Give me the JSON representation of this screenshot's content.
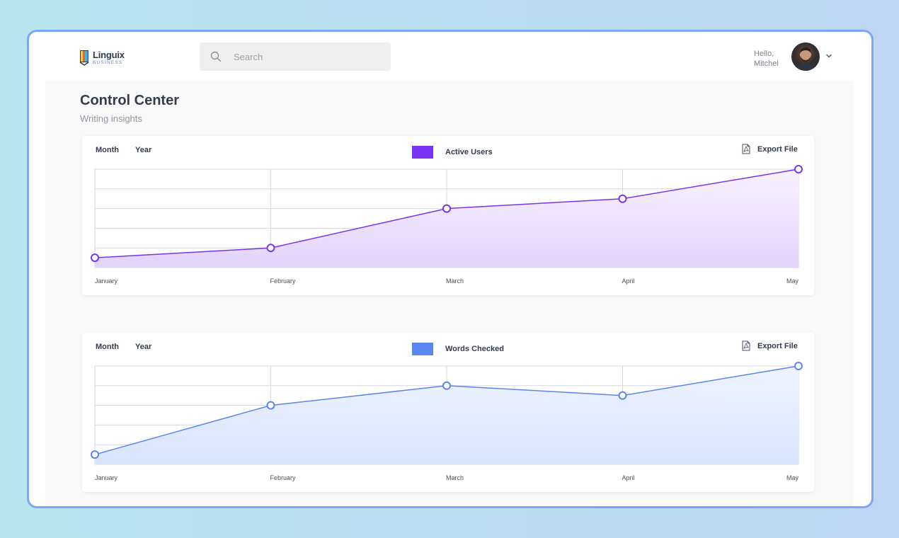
{
  "header": {
    "logo_name": "Linguix",
    "logo_sub": "BUSINESS",
    "search_placeholder": "Search",
    "greeting_line1": "Hello,",
    "greeting_line2": "Mitchel"
  },
  "page": {
    "title": "Control Center",
    "subtitle": "Writing insights"
  },
  "cards": [
    {
      "tab_month": "Month",
      "tab_year": "Year",
      "legend_label": "Active Users",
      "export_label": "Export File",
      "color": "#7a33f2",
      "fill_top": "#f8f2fe",
      "fill_bottom": "#e2d3fb"
    },
    {
      "tab_month": "Month",
      "tab_year": "Year",
      "legend_label": "Words Checked",
      "export_label": "Export File",
      "color": "#5b86f0",
      "fill_top": "#eef3fe",
      "fill_bottom": "#d9e4fc"
    }
  ],
  "chart_data": [
    {
      "type": "area",
      "categories": [
        "January",
        "February",
        "March",
        "April",
        "May"
      ],
      "series": [
        {
          "name": "Active Users",
          "values": [
            0.5,
            1.0,
            3.0,
            3.5,
            5.0
          ]
        }
      ],
      "ylim": [
        0,
        5
      ],
      "grid": true,
      "legend_position": "top-center"
    },
    {
      "type": "area",
      "categories": [
        "January",
        "February",
        "March",
        "April",
        "May"
      ],
      "series": [
        {
          "name": "Words Checked",
          "values": [
            0.5,
            3.0,
            4.0,
            3.5,
            5.0
          ]
        }
      ],
      "ylim": [
        0,
        5
      ],
      "grid": true,
      "legend_position": "top-center"
    }
  ]
}
